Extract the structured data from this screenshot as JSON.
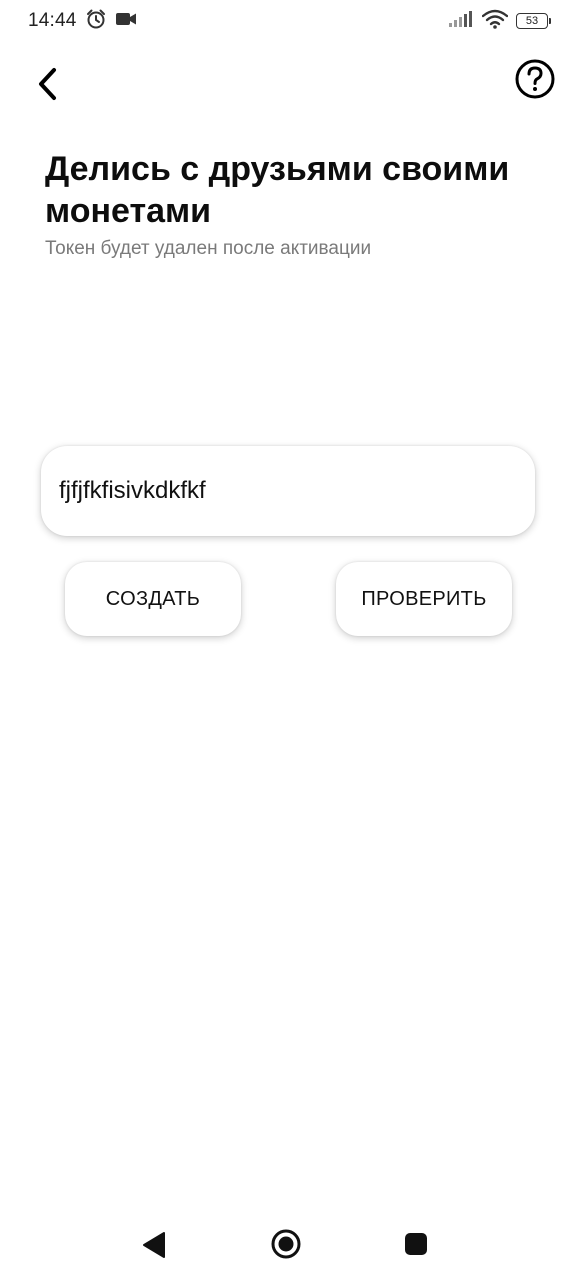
{
  "status_bar": {
    "time": "14:44",
    "battery_level": "53",
    "icons_left": [
      "alarm-icon",
      "video-camera-icon"
    ],
    "icons_right": [
      "signal-icon",
      "wifi-icon",
      "battery-icon"
    ]
  },
  "top_bar": {
    "back_icon": "chevron-left-icon",
    "help_icon": "help-circle-icon"
  },
  "header": {
    "title": "Делись с друзьями своими монетами",
    "subtitle": "Токен будет удален после активации"
  },
  "token_field": {
    "value": "fjfjfkfisivkdkfkf"
  },
  "actions": {
    "create_label": "СОЗДАТЬ",
    "check_label": "ПРОВЕРИТЬ"
  },
  "nav_bar": {
    "icons": [
      "nav-back-icon",
      "nav-home-icon",
      "nav-recents-icon"
    ]
  },
  "colors": {
    "background": "#ffffff",
    "text_primary": "#0d0d0d",
    "text_secondary": "#7a7a7a"
  }
}
